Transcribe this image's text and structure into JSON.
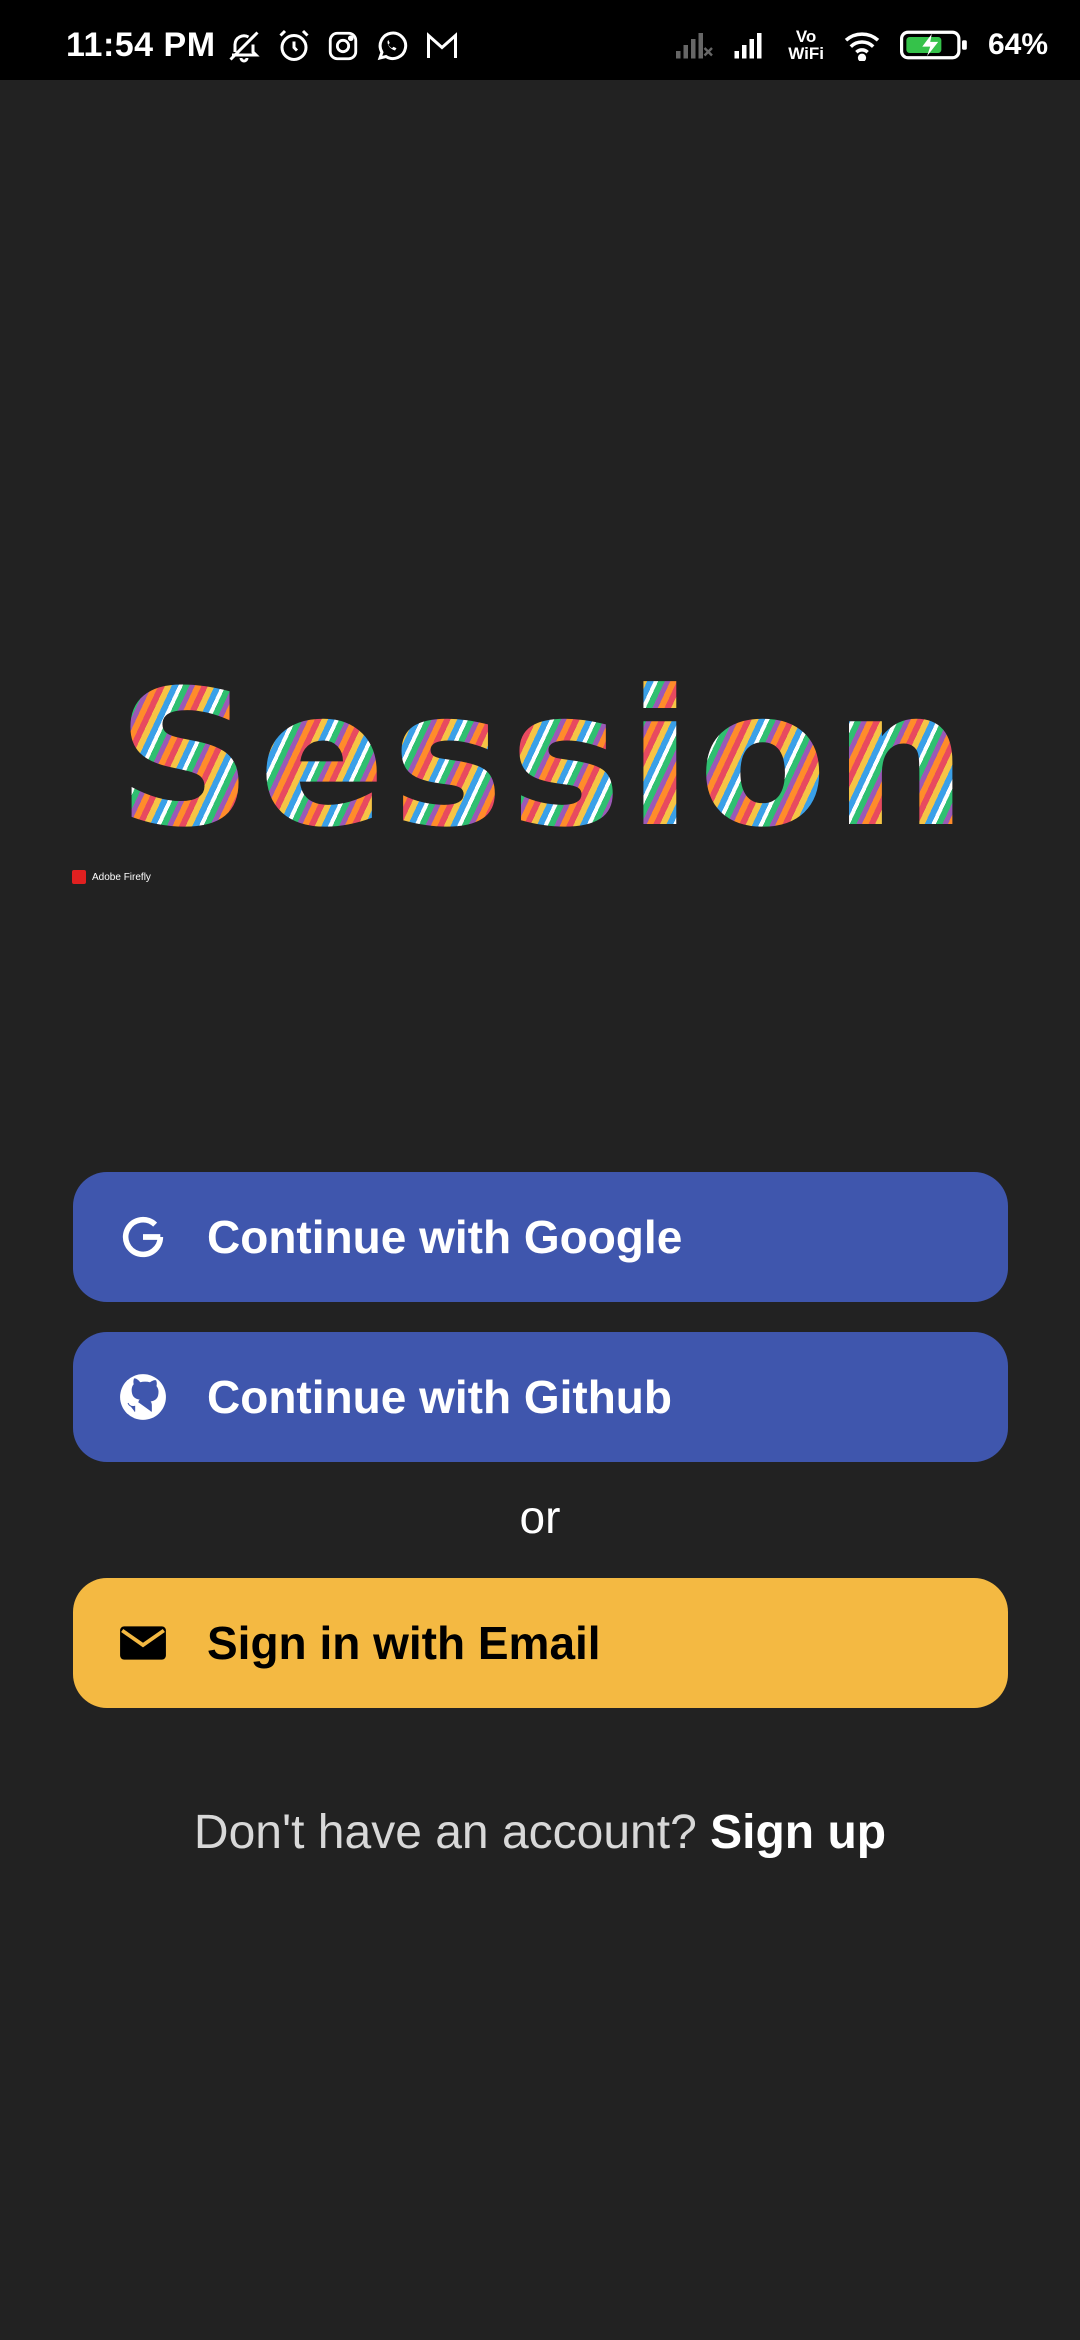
{
  "status_bar": {
    "time": "11:54 PM",
    "vowifi_top": "Vo",
    "vowifi_bottom": "WiFi",
    "battery": "64%",
    "icons_left": [
      "mute-icon",
      "alarm-icon",
      "instagram-icon",
      "whatsapp-icon",
      "gmail-icon"
    ],
    "icons_right": [
      "signal-off-icon",
      "signal-icon",
      "vowifi-icon",
      "wifi-icon",
      "battery-charging-icon"
    ]
  },
  "logo": {
    "text": "Session",
    "badge": "Adobe Firefly"
  },
  "auth": {
    "google_label": "Continue with Google",
    "github_label": "Continue with Github",
    "or_label": "or",
    "email_label": "Sign in with Email"
  },
  "signup": {
    "prompt": "Don't have an account?",
    "link": "Sign up"
  },
  "colors": {
    "background": "#222222",
    "oauth_button": "#3f56ad",
    "email_button": "#f4b942",
    "status_bar": "#000000"
  }
}
